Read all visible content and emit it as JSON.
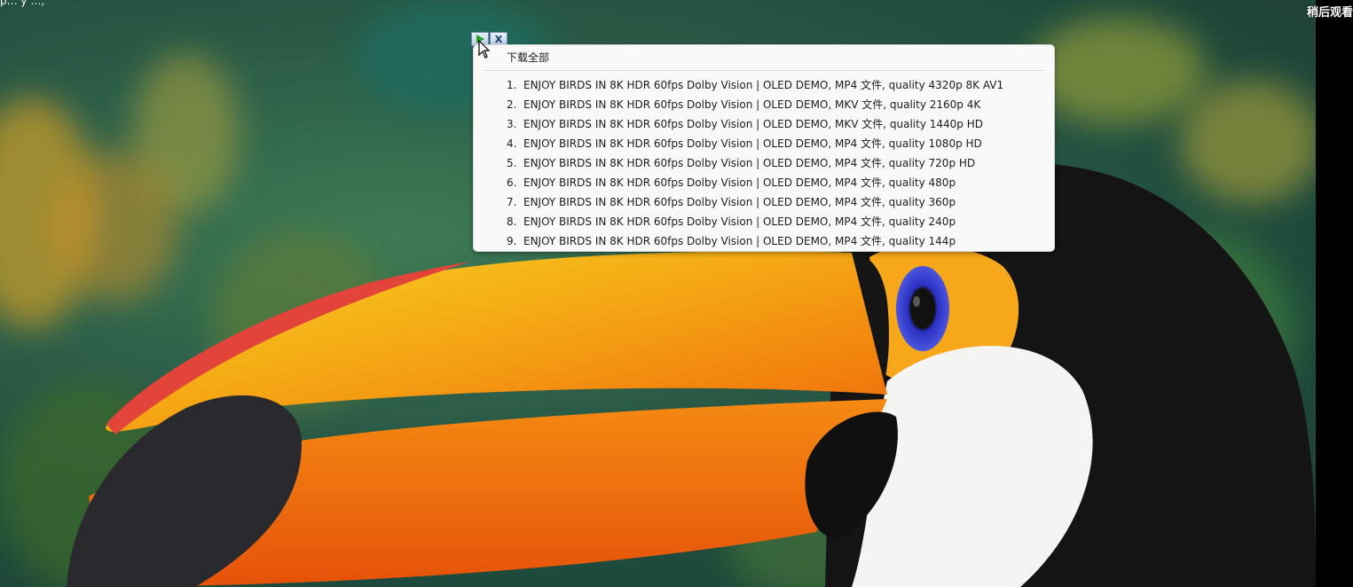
{
  "header": {
    "watch_later_label": "稍后观看",
    "top_left_text": "p… y …, "
  },
  "mini_toolbar": {
    "close_label": "X"
  },
  "download_menu": {
    "download_all_label": "下载全部",
    "items": [
      {
        "index": "1.",
        "text": "ENJOY BIRDS IN 8K HDR 60fps Dolby Vision | OLED DEMO,  MP4 文件, quality 4320p 8K AV1"
      },
      {
        "index": "2.",
        "text": "ENJOY BIRDS IN 8K HDR 60fps Dolby Vision | OLED DEMO,  MKV 文件, quality 2160p 4K"
      },
      {
        "index": "3.",
        "text": "ENJOY BIRDS IN 8K HDR 60fps Dolby Vision | OLED DEMO,  MKV 文件, quality 1440p HD"
      },
      {
        "index": "4.",
        "text": "ENJOY BIRDS IN 8K HDR 60fps Dolby Vision | OLED DEMO,  MP4 文件, quality 1080p HD"
      },
      {
        "index": "5.",
        "text": "ENJOY BIRDS IN 8K HDR 60fps Dolby Vision | OLED DEMO,  MP4 文件, quality 720p HD"
      },
      {
        "index": "6.",
        "text": "ENJOY BIRDS IN 8K HDR 60fps Dolby Vision | OLED DEMO,  MP4 文件, quality 480p"
      },
      {
        "index": "7.",
        "text": "ENJOY BIRDS IN 8K HDR 60fps Dolby Vision | OLED DEMO,  MP4 文件, quality 360p"
      },
      {
        "index": "8.",
        "text": "ENJOY BIRDS IN 8K HDR 60fps Dolby Vision | OLED DEMO,  MP4 文件, quality 240p"
      },
      {
        "index": "9.",
        "text": "ENJOY BIRDS IN 8K HDR 60fps Dolby Vision | OLED DEMO,  MP4 文件, quality 144p"
      }
    ]
  },
  "colors": {
    "menu_background": "#f9f9f9",
    "menu_text": "#1c1c1c",
    "beak_orange": "#f2780a",
    "beak_yellow": "#f7c71a",
    "beak_red": "#e5412c",
    "eye_blue": "#3a3fd0",
    "feather_black": "#131313",
    "throat_white": "#f4f4f2"
  }
}
